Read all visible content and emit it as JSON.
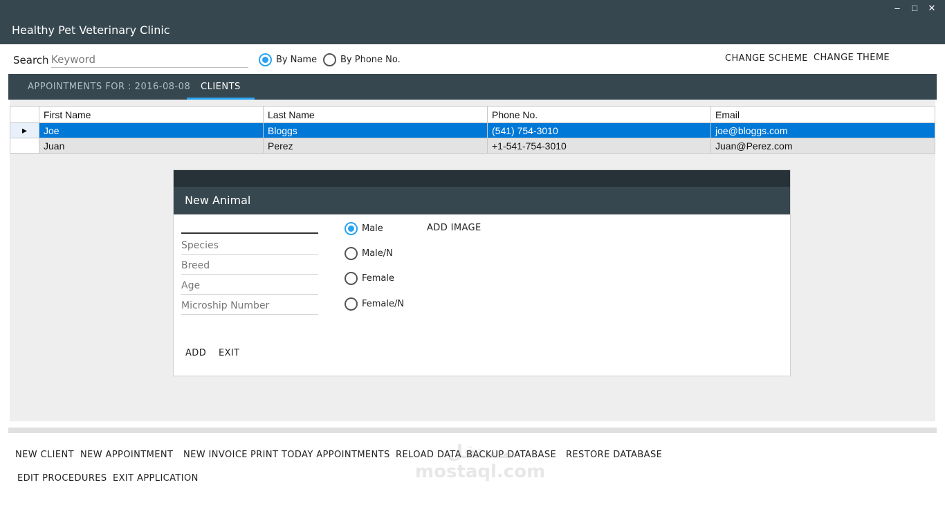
{
  "window": {
    "minimize_glyph": "–",
    "maximize_glyph": "□",
    "close_glyph": "✕"
  },
  "app": {
    "title": "Healthy Pet Veterinary Clinic"
  },
  "search": {
    "label": "Search",
    "placeholder": "Keyword",
    "by_name_label": "By Name",
    "by_phone_label": "By Phone No.",
    "selected": "By Name"
  },
  "toolbar": {
    "change_scheme": "CHANGE SCHEME",
    "change_theme": "CHANGE THEME"
  },
  "tabs": [
    {
      "label": "APPOINTMENTS FOR : 2016-08-08",
      "active": false
    },
    {
      "label": "CLIENTS",
      "active": true
    }
  ],
  "clients_table": {
    "columns": [
      "First Name",
      "Last Name",
      "Phone No.",
      "Email"
    ],
    "rows": [
      {
        "first": "Joe",
        "last": "Bloggs",
        "phone": "(541) 754-3010",
        "email": "joe@bloggs.com",
        "selected": true
      },
      {
        "first": "Juan",
        "last": "Perez",
        "phone": "+1-541-754-3010",
        "email": "Juan@Perez.com",
        "selected": false
      }
    ],
    "selected_row_marker": "▸"
  },
  "new_animal": {
    "title": "New Animal",
    "name_value": "",
    "species_placeholder": "Species",
    "breed_placeholder": "Breed",
    "age_placeholder": "Age",
    "microchip_placeholder": "Microship Number",
    "gender_options": [
      "Male",
      "Male/N",
      "Female",
      "Female/N"
    ],
    "selected_gender": "Male",
    "add_image": "ADD IMAGE",
    "add": "ADD",
    "exit": "EXIT"
  },
  "actions": {
    "row1": [
      "NEW CLIENT",
      "NEW APPOINTMENT",
      "NEW INVOICE",
      "PRINT TODAY APPOINTMENTS",
      "RELOAD DATA",
      "BACKUP DATABASE",
      "RESTORE DATABASE"
    ],
    "row2": [
      "EDIT PROCEDURES",
      "EXIT APPLICATION"
    ]
  },
  "watermark": {
    "line1": "مستقل",
    "line2": "mostaql.com"
  },
  "colors": {
    "header": "#37474f",
    "accent": "#29a3f0",
    "selection": "#0078d7"
  }
}
